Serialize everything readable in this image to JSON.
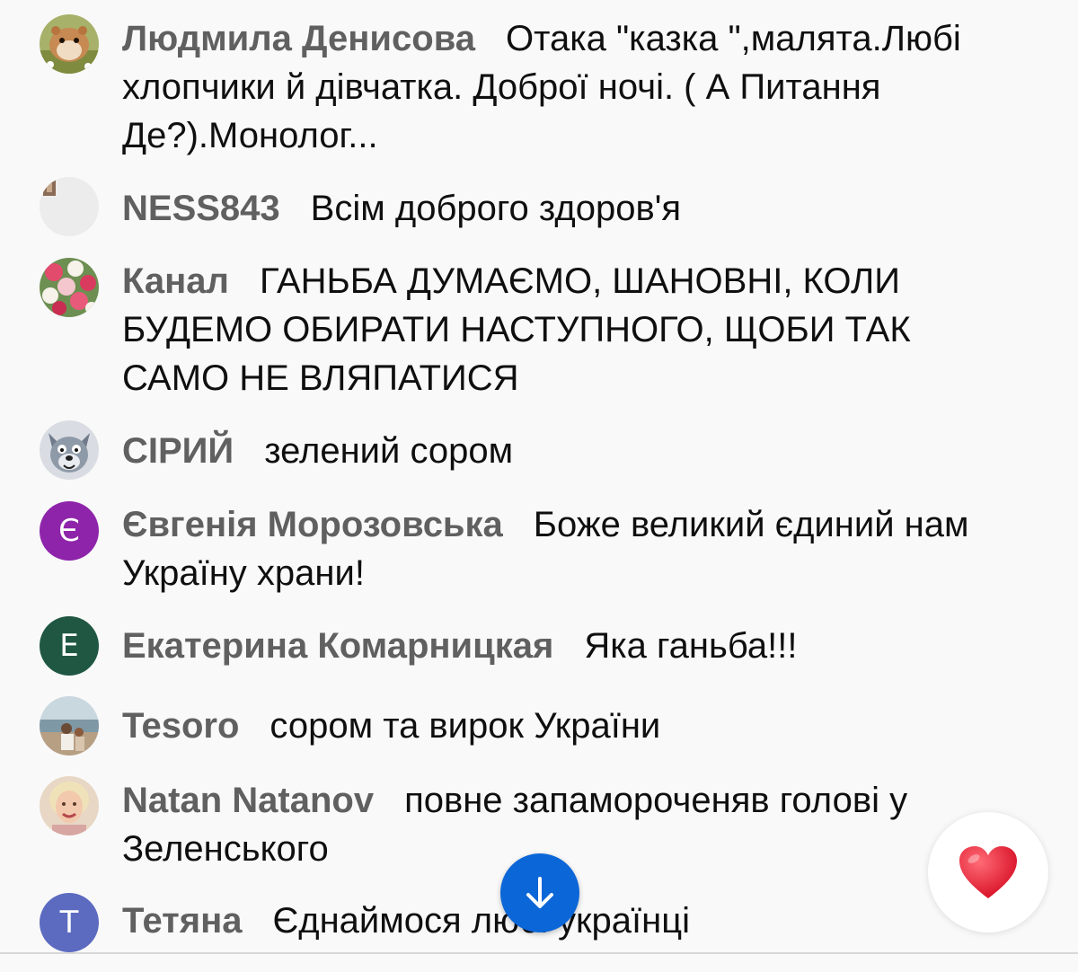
{
  "messages": [
    {
      "author": "Людмила Денисова",
      "text": "Отака \"казка \",малята.Любі хлопчики й дівчатка. Доброї ночі. ( А Питання Де?).Монолог...",
      "avatar": "hamster-photo-icon"
    },
    {
      "author": "NESS843",
      "text": "Всім доброго здоров'я",
      "avatar": "light-photo-icon"
    },
    {
      "author": "Канал",
      "text": "ГАНЬБА ДУМАЄМО, ШАНОВНІ, КОЛИ БУДЕМО ОБИРАТИ НАСТУПНОГО, ЩОБИ ТАК САМО НЕ ВЛЯПАТИСЯ",
      "avatar": "flowers-photo-icon"
    },
    {
      "author": "СІРИЙ",
      "text": "зелений сором",
      "avatar": "cartoon-wolf-icon"
    },
    {
      "author": "Євгенія Морозовська",
      "text": "Боже великий єдиний нам Україну храни!",
      "avatar_letter": "Є",
      "avatar_color": "#8e24aa"
    },
    {
      "author": "Екатерина Комарницкая",
      "text": "Яка ганьба!!!",
      "avatar_letter": "Е",
      "avatar_color": "#1f5743"
    },
    {
      "author": "Tesoro",
      "text": "сором та вирок України",
      "avatar": "beach-photo-icon"
    },
    {
      "author": "Natan Natanov",
      "text": "повне запамороченяв голові у Зеленського",
      "avatar": "woman-portrait-icon"
    },
    {
      "author": "Тетяна",
      "text": "Єднаймося любі українці",
      "avatar_letter": "Т",
      "avatar_color": "#5c6bc0"
    }
  ],
  "controls": {
    "scroll_down_icon": "arrow-down-icon",
    "reaction_icon": "heart-icon"
  },
  "colors": {
    "background": "#f9f9f9",
    "author": "#606060",
    "text": "#0f0f0f",
    "scroll_button": "#0b66d8",
    "heart": "#e0202f"
  }
}
